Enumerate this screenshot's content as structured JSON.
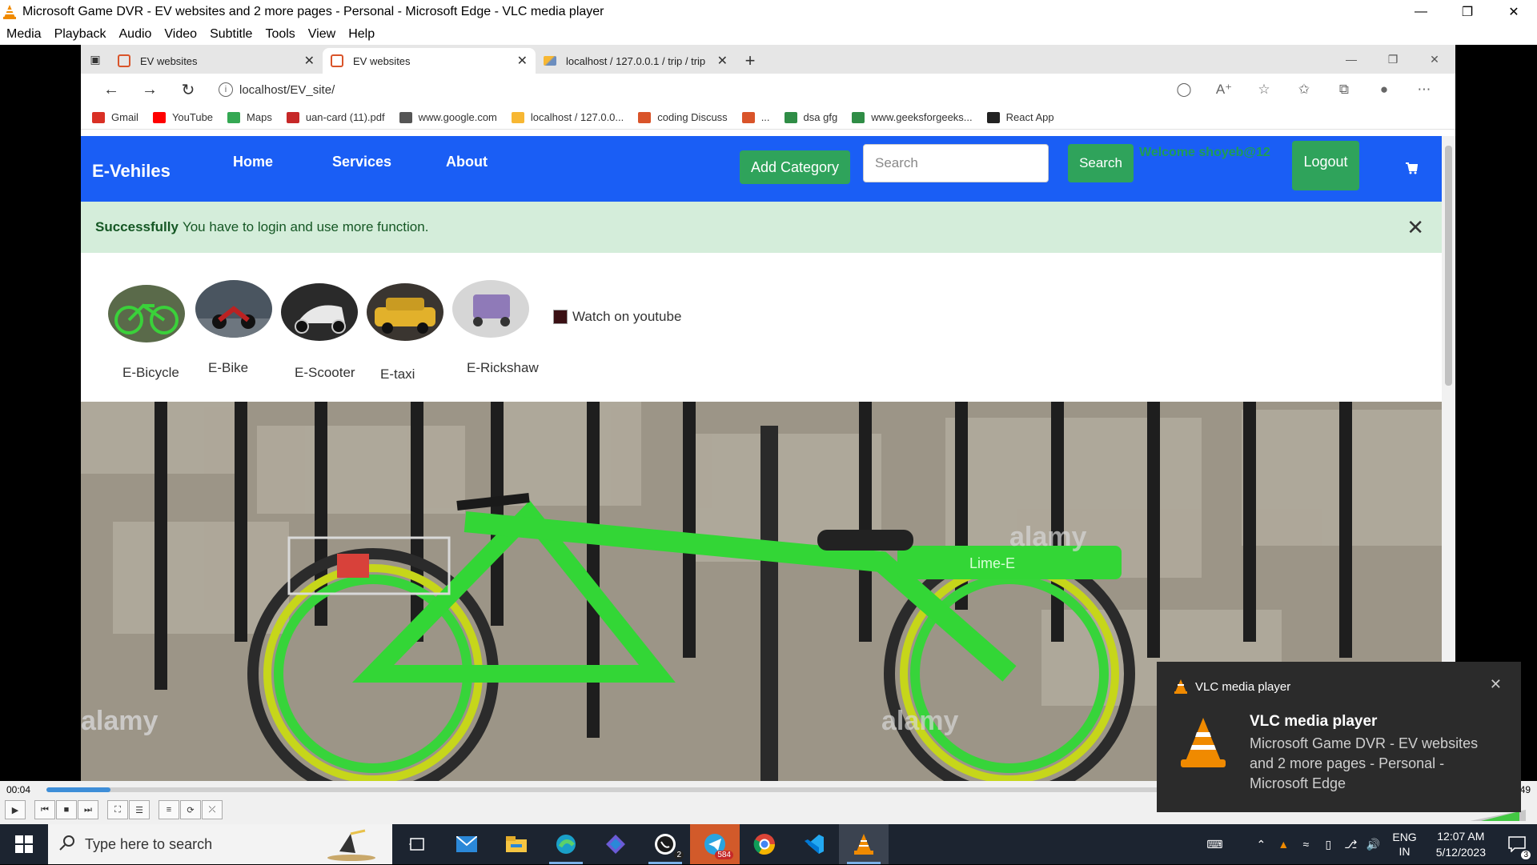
{
  "vlc": {
    "title": "Microsoft Game DVR - EV websites and 2 more pages - Personal - Microsoft Edge - VLC media player",
    "menu": [
      "Media",
      "Playback",
      "Audio",
      "Video",
      "Subtitle",
      "Tools",
      "View",
      "Help"
    ],
    "time_elapsed": "00:04",
    "time_total": "49",
    "progress": 0.044
  },
  "edge": {
    "tabs": [
      {
        "label": "EV websites",
        "active": false
      },
      {
        "label": "EV websites",
        "active": true
      },
      {
        "label": "localhost / 127.0.0.1 / trip / trip",
        "active": false
      }
    ],
    "url": "localhost/EV_site/",
    "favorites": [
      {
        "label": "Gmail",
        "icon": "gmail-icon",
        "color": "#d93025"
      },
      {
        "label": "YouTube",
        "icon": "youtube-icon",
        "color": "#ff0000"
      },
      {
        "label": "Maps",
        "icon": "maps-icon",
        "color": "#34a853"
      },
      {
        "label": "uan-card (11).pdf",
        "icon": "pdf-icon",
        "color": "#c62828"
      },
      {
        "label": "www.google.com",
        "icon": "page-icon",
        "color": "#555555"
      },
      {
        "label": "localhost / 127.0.0...",
        "icon": "phpmyadmin-icon",
        "color": "#f7b733"
      },
      {
        "label": "coding Discuss",
        "icon": "site-icon",
        "color": "#d9542a"
      },
      {
        "label": "...",
        "icon": "site-icon",
        "color": "#d9542a"
      },
      {
        "label": "dsa gfg",
        "icon": "gfg-icon",
        "color": "#2f8d46"
      },
      {
        "label": "www.geeksforgeeks...",
        "icon": "gfg-icon",
        "color": "#2f8d46"
      },
      {
        "label": "React App",
        "icon": "react-icon",
        "color": "#222222"
      }
    ]
  },
  "site": {
    "brand": "E-Vehiles",
    "nav": [
      "Home",
      "Services",
      "About"
    ],
    "add_category": "Add Category",
    "search_placeholder": "Search",
    "search_button": "Search",
    "welcome": "Welcome shoyeb@12",
    "logout": "Logout",
    "alert_strong": "Successfully",
    "alert_text": "You have to login and use more function.",
    "categories": [
      "E-Bicycle",
      "E-Bike",
      "E-Scooter",
      "E-taxi",
      "E-Rickshaw"
    ],
    "watch_label": "Watch on youtube",
    "hero_watermark": "alamy",
    "hero_text": "Lime-E"
  },
  "toast": {
    "app": "VLC media player",
    "title": "VLC media player",
    "body": "Microsoft Game DVR - EV websites and 2 more pages - Personal - Microsoft Edge"
  },
  "taskbar": {
    "search_placeholder": "Type here to search",
    "lang_top": "ENG",
    "lang_bottom": "IN",
    "time": "12:07 AM",
    "date": "5/12/2023",
    "whatsapp_badge": "2",
    "telegram_badge": "584",
    "notif_badge": "3"
  },
  "colors": {
    "navbar": "#1a5ef5",
    "green_button": "#2fa35b",
    "alert_bg": "#d4edda",
    "vlc_orange": "#f08a00"
  }
}
